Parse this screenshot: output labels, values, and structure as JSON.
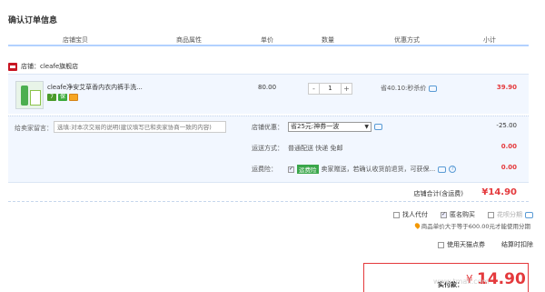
{
  "page": {
    "title": "确认订单信息"
  },
  "columns": [
    "店铺宝贝",
    "商品属性",
    "单价",
    "数量",
    "优惠方式",
    "小计"
  ],
  "shop": {
    "label": "店铺：cleafe旗舰店"
  },
  "item": {
    "name": "cleafe净安艾草香内衣内裤手洗...",
    "badges": [
      "7",
      "保"
    ],
    "unit_price": "80.00",
    "qty_minus": "-",
    "qty": "1",
    "qty_plus": "+",
    "discount": "省40.10:秒杀价",
    "subtotal": "39.90"
  },
  "options": {
    "message_label": "给卖家留言：",
    "message_placeholder": "选填:对本次交易的说明(建议填写已和卖家协商一致的内容)",
    "store_discount_label": "店铺优惠：",
    "store_discount_value": "省25元:神券一波",
    "store_discount_amount": "-25.00",
    "shipping_label": "运送方式：",
    "shipping_value": "普通配送 快递 免邮",
    "shipping_amount": "0.00",
    "insurance_label": "运费险：",
    "insurance_tag": "运费险",
    "insurance_text": "卖家赠送，若确认收货前退货，可获保...",
    "insurance_amount": "0.00"
  },
  "store_total": {
    "label": "店铺合计(含运费)",
    "value": "¥14.90"
  },
  "extra": {
    "proxy_pay": "找人代付",
    "anonymous": "匿名购买",
    "installment": "花呗分期",
    "installment_note": "商品单价大于等于600.00元才能使用分期"
  },
  "points": {
    "tmall_points": "使用天猫点券",
    "settle_deduct": "结算时扣除"
  },
  "payment": {
    "label": "实付款：",
    "currency": "¥",
    "amount": "14.90"
  },
  "watermark": "www.tmall.com"
}
